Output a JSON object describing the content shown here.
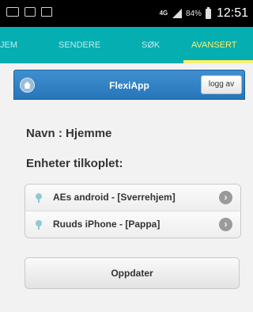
{
  "status_bar": {
    "icons": [
      "message-icon",
      "gallery-icon",
      "image-icon"
    ],
    "network": "4G",
    "battery": "84%",
    "time": "12:51"
  },
  "tabs": [
    {
      "label": "JEM",
      "active": false
    },
    {
      "label": "SENDERE",
      "active": false
    },
    {
      "label": "SØK",
      "active": false
    },
    {
      "label": "AVANSERT",
      "active": true
    }
  ],
  "app": {
    "title": "FlexiApp",
    "logout_label": "logg av",
    "name_line": "Navn : Hjemme",
    "devices_heading": "Enheter tilkoplet:",
    "devices": [
      {
        "label": "AEs android - [Sverrehjem]"
      },
      {
        "label": "Ruuds iPhone - [Pappa]"
      }
    ],
    "update_label": "Oppdater"
  },
  "colors": {
    "tab_bar": "#05aeb0",
    "active_tab": "#ffef6b",
    "header": "#2676ba"
  }
}
